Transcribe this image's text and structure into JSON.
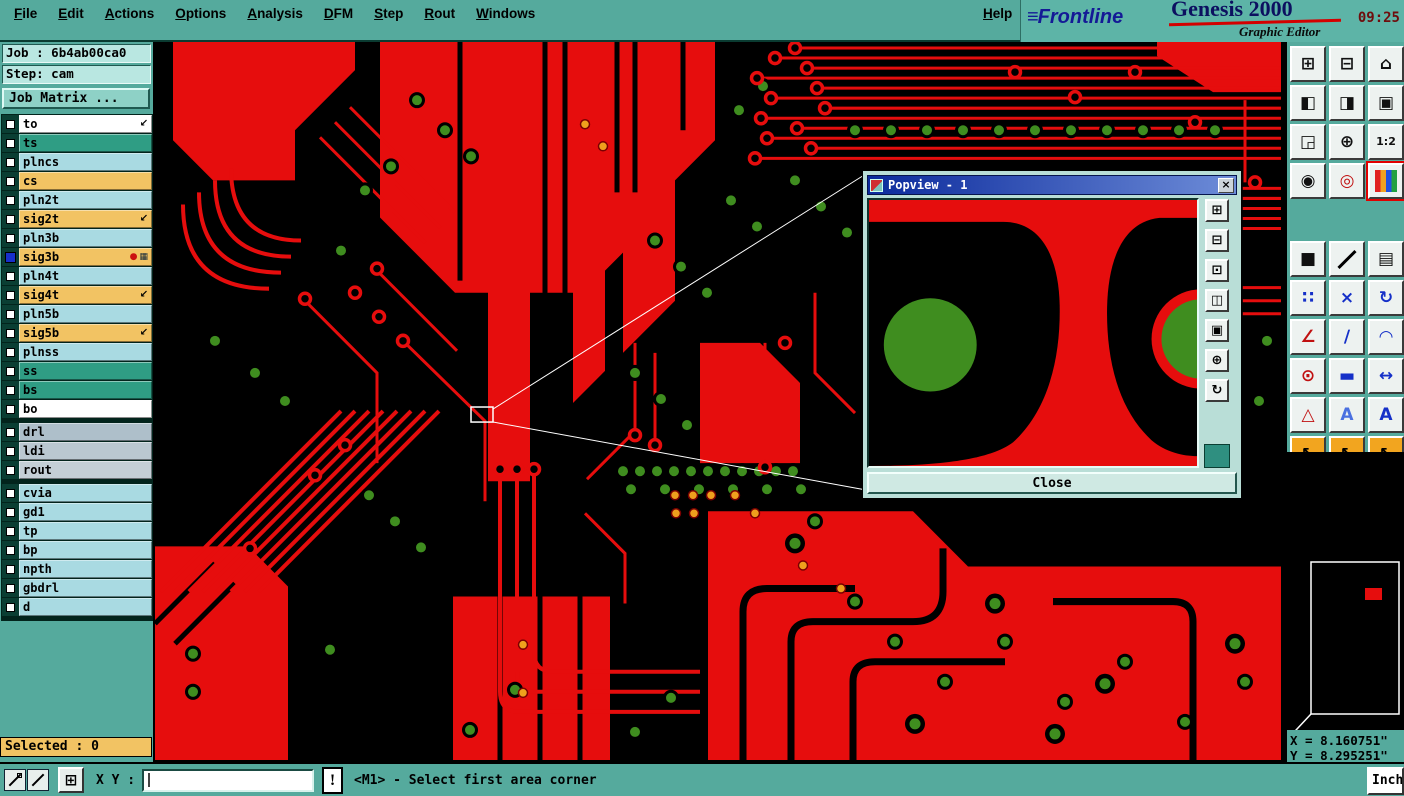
{
  "menubar": {
    "items": [
      "File",
      "Edit",
      "Actions",
      "Options",
      "Analysis",
      "DFM",
      "Step",
      "Rout",
      "Windows"
    ],
    "help": "Help"
  },
  "brand": {
    "logo_prefix": "≡",
    "logo": "Frontline",
    "product": "Genesis 2000",
    "edition": "Graphic Editor",
    "time": "09:25"
  },
  "sidebar": {
    "job": {
      "label": "Job :",
      "value": "6b4ab00ca0"
    },
    "step": {
      "label": "Step:",
      "value": "cam"
    },
    "job_matrix_button": "Job Matrix ...",
    "selected_status": "Selected : 0",
    "layer_groups": [
      {
        "layers": [
          {
            "name": "to",
            "type": "white",
            "flag": "arrow"
          },
          {
            "name": "ts",
            "type": "teal"
          },
          {
            "name": "plncs",
            "type": "blue"
          },
          {
            "name": "cs",
            "type": "orange"
          },
          {
            "name": "pln2t",
            "type": "blue"
          },
          {
            "name": "sig2t",
            "type": "orange",
            "flag": "arrow"
          },
          {
            "name": "pln3b",
            "type": "blue"
          },
          {
            "name": "sig3b",
            "type": "orange",
            "flag": "active",
            "work": true
          },
          {
            "name": "pln4t",
            "type": "blue"
          },
          {
            "name": "sig4t",
            "type": "orange",
            "flag": "arrow"
          },
          {
            "name": "pln5b",
            "type": "blue"
          },
          {
            "name": "sig5b",
            "type": "orange",
            "flag": "arrow"
          },
          {
            "name": "plnss",
            "type": "blue"
          },
          {
            "name": "ss",
            "type": "teal"
          },
          {
            "name": "bs",
            "type": "teal"
          },
          {
            "name": "bo",
            "type": "white"
          }
        ]
      },
      {
        "layers": [
          {
            "name": "drl",
            "type": "gray1"
          },
          {
            "name": "ldi",
            "type": "gray2"
          },
          {
            "name": "rout",
            "type": "gray3"
          }
        ]
      },
      {
        "layers": [
          {
            "name": "cvia",
            "type": "blue"
          },
          {
            "name": "gd1",
            "type": "blue"
          },
          {
            "name": "tp",
            "type": "blue"
          },
          {
            "name": "bp",
            "type": "blue"
          },
          {
            "name": "npth",
            "type": "blue"
          },
          {
            "name": "gbdrl",
            "type": "blue"
          },
          {
            "name": "d",
            "type": "blue"
          }
        ]
      }
    ]
  },
  "toolbar": {
    "buttons": [
      {
        "name": "copy-window",
        "glyph": "⊞"
      },
      {
        "name": "paste-window",
        "glyph": "⊟"
      },
      {
        "name": "home-view",
        "glyph": "⌂"
      },
      {
        "name": "pan-left",
        "glyph": "◧"
      },
      {
        "name": "pan-right",
        "glyph": "◨"
      },
      {
        "name": "restore-view",
        "glyph": "▣"
      },
      {
        "name": "zoom-window",
        "glyph": "◲"
      },
      {
        "name": "zoom-center",
        "glyph": "⊕"
      },
      {
        "name": "zoom-1-2",
        "glyph": "1:2"
      },
      {
        "name": "redraw",
        "glyph": "◉"
      },
      {
        "name": "highlight-point",
        "glyph": "◎",
        "cls": "red"
      },
      {
        "name": "layer-colors",
        "glyph": "",
        "cls": "rainbow hl"
      },
      {
        "name": "solid-fill",
        "glyph": "■"
      },
      {
        "name": "draw-line",
        "glyph": "",
        "cls": "diag"
      },
      {
        "name": "ruler",
        "glyph": "▤"
      },
      {
        "name": "net-points",
        "glyph": "∷",
        "cls": "blue"
      },
      {
        "name": "delete-x",
        "glyph": "×",
        "cls": "blue"
      },
      {
        "name": "rotate",
        "glyph": "↻",
        "cls": "blue"
      },
      {
        "name": "angle-measure",
        "glyph": "∠",
        "cls": "red"
      },
      {
        "name": "slope-line",
        "glyph": "∕",
        "cls": "blue"
      },
      {
        "name": "arc-tool",
        "glyph": "◠",
        "cls": "blue"
      },
      {
        "name": "target-point",
        "glyph": "⊙",
        "cls": "red"
      },
      {
        "name": "width-bar",
        "glyph": "▬",
        "cls": "blue"
      },
      {
        "name": "distance-measure",
        "glyph": "↔",
        "cls": "blue"
      },
      {
        "name": "dfm-triangle",
        "glyph": "△",
        "cls": "red"
      },
      {
        "name": "text-outline",
        "glyph": "A",
        "cls": "blue-light"
      },
      {
        "name": "text-filled",
        "glyph": "A",
        "cls": "blue"
      },
      {
        "name": "select-arrow",
        "glyph": "↖",
        "cls": "orange"
      },
      {
        "name": "select-arrow-alt",
        "glyph": "↖",
        "cls": "orange"
      },
      {
        "name": "select-arrow-circle",
        "glyph": "↖",
        "cls": "orange"
      }
    ]
  },
  "popview": {
    "title": "Popview - 1",
    "close_x": "×",
    "close_button": "Close",
    "tools": [
      {
        "name": "pv-copy",
        "glyph": "⊞"
      },
      {
        "name": "pv-zoom-out",
        "glyph": "⊟"
      },
      {
        "name": "pv-pan",
        "glyph": "⊡"
      },
      {
        "name": "pv-prev-view",
        "glyph": "◫"
      },
      {
        "name": "pv-next-view",
        "glyph": "▣"
      },
      {
        "name": "pv-zoom-fit",
        "glyph": "⊕"
      },
      {
        "name": "pv-refresh",
        "glyph": "↻"
      }
    ]
  },
  "coords": {
    "x": "X = 8.160751\"",
    "y": "Y = 8.295251\""
  },
  "statusbar": {
    "xy_label": "X Y :",
    "xy_value": "",
    "grid_icon": "⊞",
    "alert": "!",
    "message": "<M1> - Select first area corner",
    "units": "Inch"
  }
}
